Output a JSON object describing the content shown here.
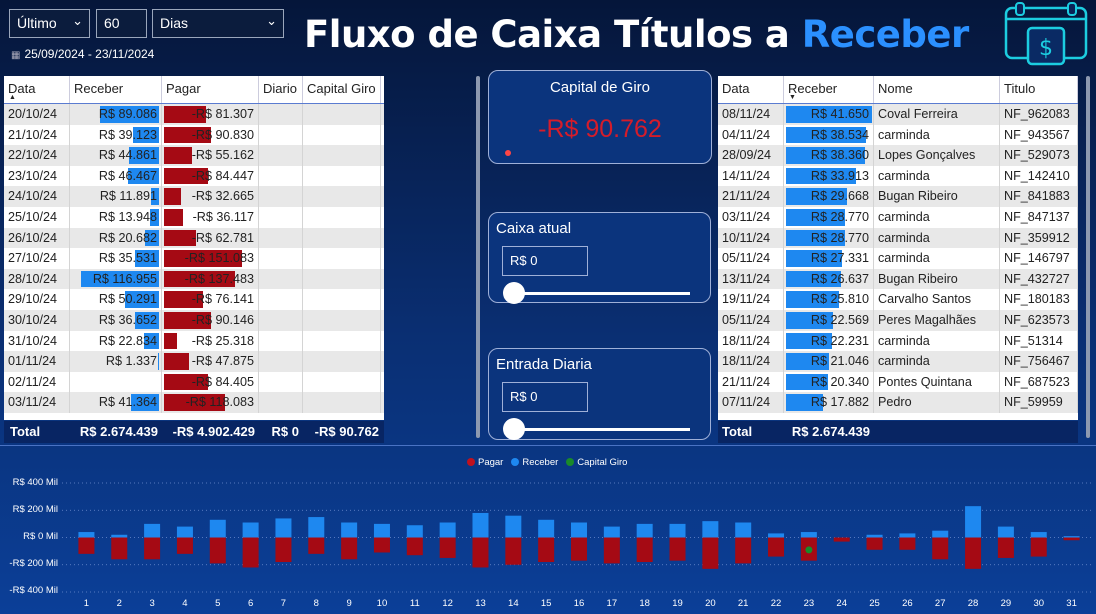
{
  "header": {
    "filter_mode": "Último",
    "filter_count": "60",
    "filter_unit": "Dias",
    "date_range": "25/09/2024 - 23/11/2024",
    "title_main": "Fluxo de Caixa Títulos a",
    "title_accent": "Receber"
  },
  "left_table": {
    "columns": [
      "Data",
      "Receber",
      "Pagar",
      "Diario",
      "Capital Giro"
    ],
    "rows": [
      {
        "data": "20/10/24",
        "receber": "R$ 89.086",
        "rv": 89086,
        "pagar": "-R$ 81.307",
        "pv": 81307
      },
      {
        "data": "21/10/24",
        "receber": "R$ 39.123",
        "rv": 39123,
        "pagar": "-R$ 90.830",
        "pv": 90830
      },
      {
        "data": "22/10/24",
        "receber": "R$ 44.861",
        "rv": 44861,
        "pagar": "-R$ 55.162",
        "pv": 55162
      },
      {
        "data": "23/10/24",
        "receber": "R$ 46.467",
        "rv": 46467,
        "pagar": "-R$ 84.447",
        "pv": 84447
      },
      {
        "data": "24/10/24",
        "receber": "R$ 11.891",
        "rv": 11891,
        "pagar": "-R$ 32.665",
        "pv": 32665
      },
      {
        "data": "25/10/24",
        "receber": "R$ 13.948",
        "rv": 13948,
        "pagar": "-R$ 36.117",
        "pv": 36117
      },
      {
        "data": "26/10/24",
        "receber": "R$ 20.682",
        "rv": 20682,
        "pagar": "-R$ 62.781",
        "pv": 62781
      },
      {
        "data": "27/10/24",
        "receber": "R$ 35.531",
        "rv": 35531,
        "pagar": "-R$ 151.083",
        "pv": 151083
      },
      {
        "data": "28/10/24",
        "receber": "R$ 116.955",
        "rv": 116955,
        "pagar": "-R$ 137.483",
        "pv": 137483
      },
      {
        "data": "29/10/24",
        "receber": "R$ 50.291",
        "rv": 50291,
        "pagar": "-R$ 76.141",
        "pv": 76141
      },
      {
        "data": "30/10/24",
        "receber": "R$ 36.652",
        "rv": 36652,
        "pagar": "-R$ 90.146",
        "pv": 90146
      },
      {
        "data": "31/10/24",
        "receber": "R$ 22.834",
        "rv": 22834,
        "pagar": "-R$ 25.318",
        "pv": 25318
      },
      {
        "data": "01/11/24",
        "receber": "R$ 1.337",
        "rv": 1337,
        "pagar": "-R$ 47.875",
        "pv": 47875
      },
      {
        "data": "02/11/24",
        "receber": "",
        "rv": 0,
        "pagar": "-R$ 84.405",
        "pv": 84405
      },
      {
        "data": "03/11/24",
        "receber": "R$ 41.364",
        "rv": 41364,
        "pagar": "-R$ 118.083",
        "pv": 118083
      }
    ],
    "total": {
      "label": "Total",
      "receber": "R$ 2.674.439",
      "pagar": "-R$ 4.902.429",
      "diario": "R$ 0",
      "capital": "-R$ 90.762"
    }
  },
  "cards": {
    "capital_title": "Capital de Giro",
    "capital_value": "-R$ 90.762",
    "caixa_title": "Caixa atual",
    "caixa_value": "R$ 0",
    "entrada_title": "Entrada Diaria",
    "entrada_value": "R$ 0"
  },
  "right_table": {
    "columns": [
      "Data",
      "Receber",
      "Nome",
      "Titulo"
    ],
    "rows": [
      {
        "data": "08/11/24",
        "receber": "R$ 41.650",
        "rv": 41650,
        "nome": "Coval Ferreira",
        "titulo": "NF_962083"
      },
      {
        "data": "04/11/24",
        "receber": "R$ 38.534",
        "rv": 38534,
        "nome": "carminda",
        "titulo": "NF_943567"
      },
      {
        "data": "28/09/24",
        "receber": "R$ 38.360",
        "rv": 38360,
        "nome": "Lopes Gonçalves",
        "titulo": "NF_529073"
      },
      {
        "data": "14/11/24",
        "receber": "R$ 33.913",
        "rv": 33913,
        "nome": "carminda",
        "titulo": "NF_142410"
      },
      {
        "data": "21/11/24",
        "receber": "R$ 29.668",
        "rv": 29668,
        "nome": "Bugan Ribeiro",
        "titulo": "NF_841883"
      },
      {
        "data": "03/11/24",
        "receber": "R$ 28.770",
        "rv": 28770,
        "nome": "carminda",
        "titulo": "NF_847137"
      },
      {
        "data": "10/11/24",
        "receber": "R$ 28.770",
        "rv": 28770,
        "nome": "carminda",
        "titulo": "NF_359912"
      },
      {
        "data": "05/11/24",
        "receber": "R$ 27.331",
        "rv": 27331,
        "nome": "carminda",
        "titulo": "NF_146797"
      },
      {
        "data": "13/11/24",
        "receber": "R$ 26.637",
        "rv": 26637,
        "nome": "Bugan Ribeiro",
        "titulo": "NF_432727"
      },
      {
        "data": "19/11/24",
        "receber": "R$ 25.810",
        "rv": 25810,
        "nome": "Carvalho Santos",
        "titulo": "NF_180183"
      },
      {
        "data": "05/11/24",
        "receber": "R$ 22.569",
        "rv": 22569,
        "nome": "Peres Magalhães",
        "titulo": "NF_623573"
      },
      {
        "data": "18/11/24",
        "receber": "R$ 22.231",
        "rv": 22231,
        "nome": "carminda",
        "titulo": "NF_51314"
      },
      {
        "data": "18/11/24",
        "receber": "R$ 21.046",
        "rv": 21046,
        "nome": "carminda",
        "titulo": "NF_756467"
      },
      {
        "data": "21/11/24",
        "receber": "R$ 20.340",
        "rv": 20340,
        "nome": "Pontes Quintana",
        "titulo": "NF_687523"
      },
      {
        "data": "07/11/24",
        "receber": "R$ 17.882",
        "rv": 17882,
        "nome": "Pedro",
        "titulo": "NF_59959"
      }
    ],
    "total": {
      "label": "Total",
      "receber": "R$ 2.674.439"
    }
  },
  "colors": {
    "receber": "#1e88f0",
    "pagar": "#a50a14",
    "capital": "#1a8a2a"
  },
  "chart_data": {
    "type": "bar",
    "legend": [
      "Pagar",
      "Receber",
      "Capital Giro"
    ],
    "legend_position": "top-center",
    "y_ticks": [
      "R$ 400 Mil",
      "R$ 200 Mil",
      "R$ 0 Mil",
      "-R$ 200 Mil",
      "-R$ 400 Mil"
    ],
    "ylim": [
      -400000,
      400000
    ],
    "categories": [
      "1",
      "2",
      "3",
      "4",
      "5",
      "6",
      "7",
      "8",
      "9",
      "10",
      "11",
      "12",
      "13",
      "14",
      "15",
      "16",
      "17",
      "18",
      "19",
      "20",
      "21",
      "22",
      "23",
      "24",
      "25",
      "26",
      "27",
      "28",
      "29",
      "30",
      "31"
    ],
    "series": [
      {
        "name": "Receber",
        "values": [
          40000,
          20000,
          100000,
          80000,
          130000,
          110000,
          140000,
          150000,
          110000,
          100000,
          90000,
          110000,
          180000,
          160000,
          130000,
          110000,
          80000,
          100000,
          100000,
          120000,
          110000,
          30000,
          40000,
          0,
          20000,
          30000,
          50000,
          230000,
          80000,
          40000,
          10000
        ]
      },
      {
        "name": "Pagar",
        "values": [
          -120000,
          -160000,
          -160000,
          -120000,
          -190000,
          -220000,
          -180000,
          -120000,
          -160000,
          -110000,
          -130000,
          -150000,
          -220000,
          -200000,
          -180000,
          -170000,
          -190000,
          -180000,
          -170000,
          -230000,
          -190000,
          -140000,
          -170000,
          -30000,
          -90000,
          -90000,
          -160000,
          -230000,
          -150000,
          -140000,
          -20000
        ]
      },
      {
        "name": "Capital Giro",
        "values": [
          null,
          null,
          null,
          null,
          null,
          null,
          null,
          null,
          null,
          null,
          null,
          null,
          null,
          null,
          null,
          null,
          null,
          null,
          null,
          null,
          null,
          null,
          -90762,
          null,
          null,
          null,
          null,
          null,
          null,
          null,
          null
        ]
      }
    ],
    "grid": true
  }
}
